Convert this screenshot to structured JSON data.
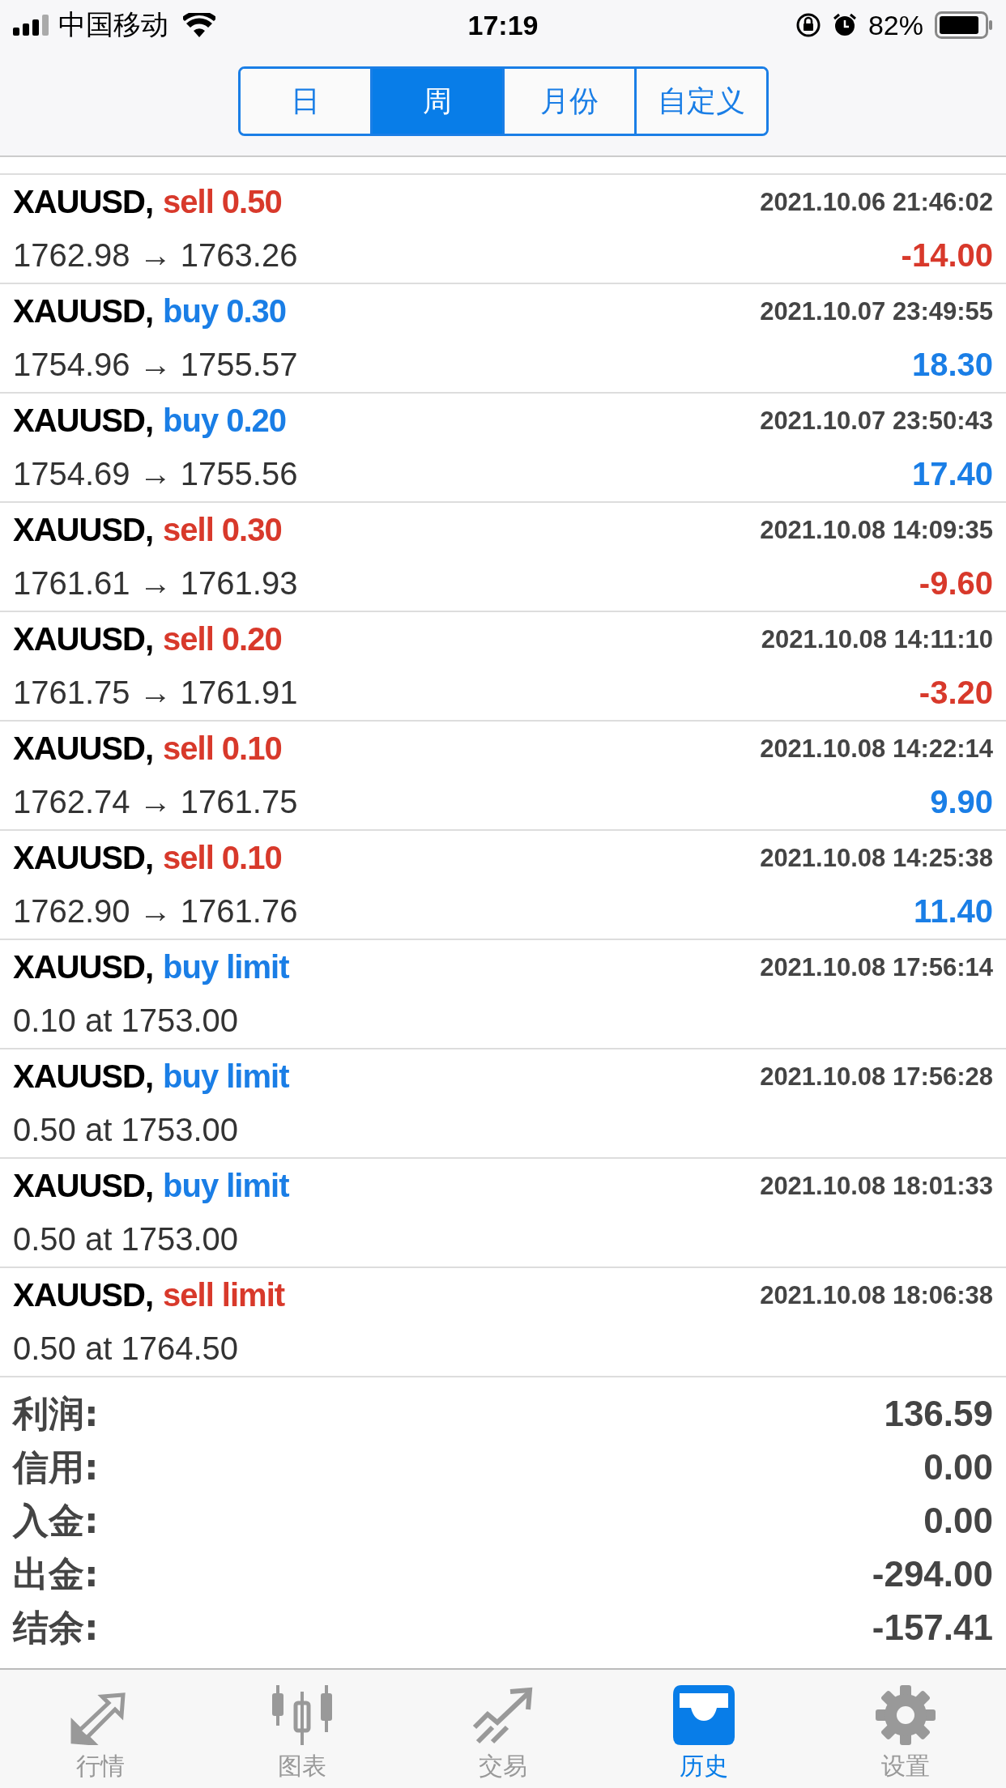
{
  "status_bar": {
    "carrier": "中国移动",
    "time": "17:19",
    "battery": "82%"
  },
  "period_tabs": [
    {
      "label": "日",
      "selected": false
    },
    {
      "label": "周",
      "selected": true
    },
    {
      "label": "月份",
      "selected": false
    },
    {
      "label": "自定义",
      "selected": false
    }
  ],
  "history": [
    {
      "symbol": "XAUUSD,",
      "order": {
        "text": "sell 0.50",
        "color": "#d8392b"
      },
      "time": "2021.10.06 21:46:02",
      "detail": "1762.98 → 1763.26",
      "profit": {
        "text": "-14.00",
        "color": "#d8392b"
      }
    },
    {
      "symbol": "XAUUSD,",
      "order": {
        "text": "buy 0.30",
        "color": "#1a7ee6"
      },
      "time": "2021.10.07 23:49:55",
      "detail": "1754.96 → 1755.57",
      "profit": {
        "text": "18.30",
        "color": "#1a7ee6"
      }
    },
    {
      "symbol": "XAUUSD,",
      "order": {
        "text": "buy 0.20",
        "color": "#1a7ee6"
      },
      "time": "2021.10.07 23:50:43",
      "detail": "1754.69 → 1755.56",
      "profit": {
        "text": "17.40",
        "color": "#1a7ee6"
      }
    },
    {
      "symbol": "XAUUSD,",
      "order": {
        "text": "sell 0.30",
        "color": "#d8392b"
      },
      "time": "2021.10.08 14:09:35",
      "detail": "1761.61 → 1761.93",
      "profit": {
        "text": "-9.60",
        "color": "#d8392b"
      }
    },
    {
      "symbol": "XAUUSD,",
      "order": {
        "text": "sell 0.20",
        "color": "#d8392b"
      },
      "time": "2021.10.08 14:11:10",
      "detail": "1761.75 → 1761.91",
      "profit": {
        "text": "-3.20",
        "color": "#d8392b"
      }
    },
    {
      "symbol": "XAUUSD,",
      "order": {
        "text": "sell 0.10",
        "color": "#d8392b"
      },
      "time": "2021.10.08 14:22:14",
      "detail": "1762.74 → 1761.75",
      "profit": {
        "text": "9.90",
        "color": "#1a7ee6"
      }
    },
    {
      "symbol": "XAUUSD,",
      "order": {
        "text": "sell 0.10",
        "color": "#d8392b"
      },
      "time": "2021.10.08 14:25:38",
      "detail": "1762.90 → 1761.76",
      "profit": {
        "text": "11.40",
        "color": "#1a7ee6"
      }
    },
    {
      "symbol": "XAUUSD,",
      "order": {
        "text": "buy limit",
        "color": "#1a7ee6"
      },
      "time": "2021.10.08 17:56:14",
      "detail": "0.10 at 1753.00"
    },
    {
      "symbol": "XAUUSD,",
      "order": {
        "text": "buy limit",
        "color": "#1a7ee6"
      },
      "time": "2021.10.08 17:56:28",
      "detail": "0.50 at 1753.00"
    },
    {
      "symbol": "XAUUSD,",
      "order": {
        "text": "buy limit",
        "color": "#1a7ee6"
      },
      "time": "2021.10.08 18:01:33",
      "detail": "0.50 at 1753.00"
    },
    {
      "symbol": "XAUUSD,",
      "order": {
        "text": "sell limit",
        "color": "#d8392b"
      },
      "time": "2021.10.08 18:06:38",
      "detail": "0.50 at 1764.50"
    }
  ],
  "summary": [
    {
      "label": "利润:",
      "value": "136.59"
    },
    {
      "label": "信用:",
      "value": "0.00"
    },
    {
      "label": "入金:",
      "value": "0.00"
    },
    {
      "label": "出金:",
      "value": "-294.00"
    },
    {
      "label": "结余:",
      "value": "-157.41"
    }
  ],
  "tab_bar": [
    {
      "label": "行情",
      "selected": false
    },
    {
      "label": "图表",
      "selected": false
    },
    {
      "label": "交易",
      "selected": false
    },
    {
      "label": "历史",
      "selected": true
    },
    {
      "label": "设置",
      "selected": false
    }
  ]
}
